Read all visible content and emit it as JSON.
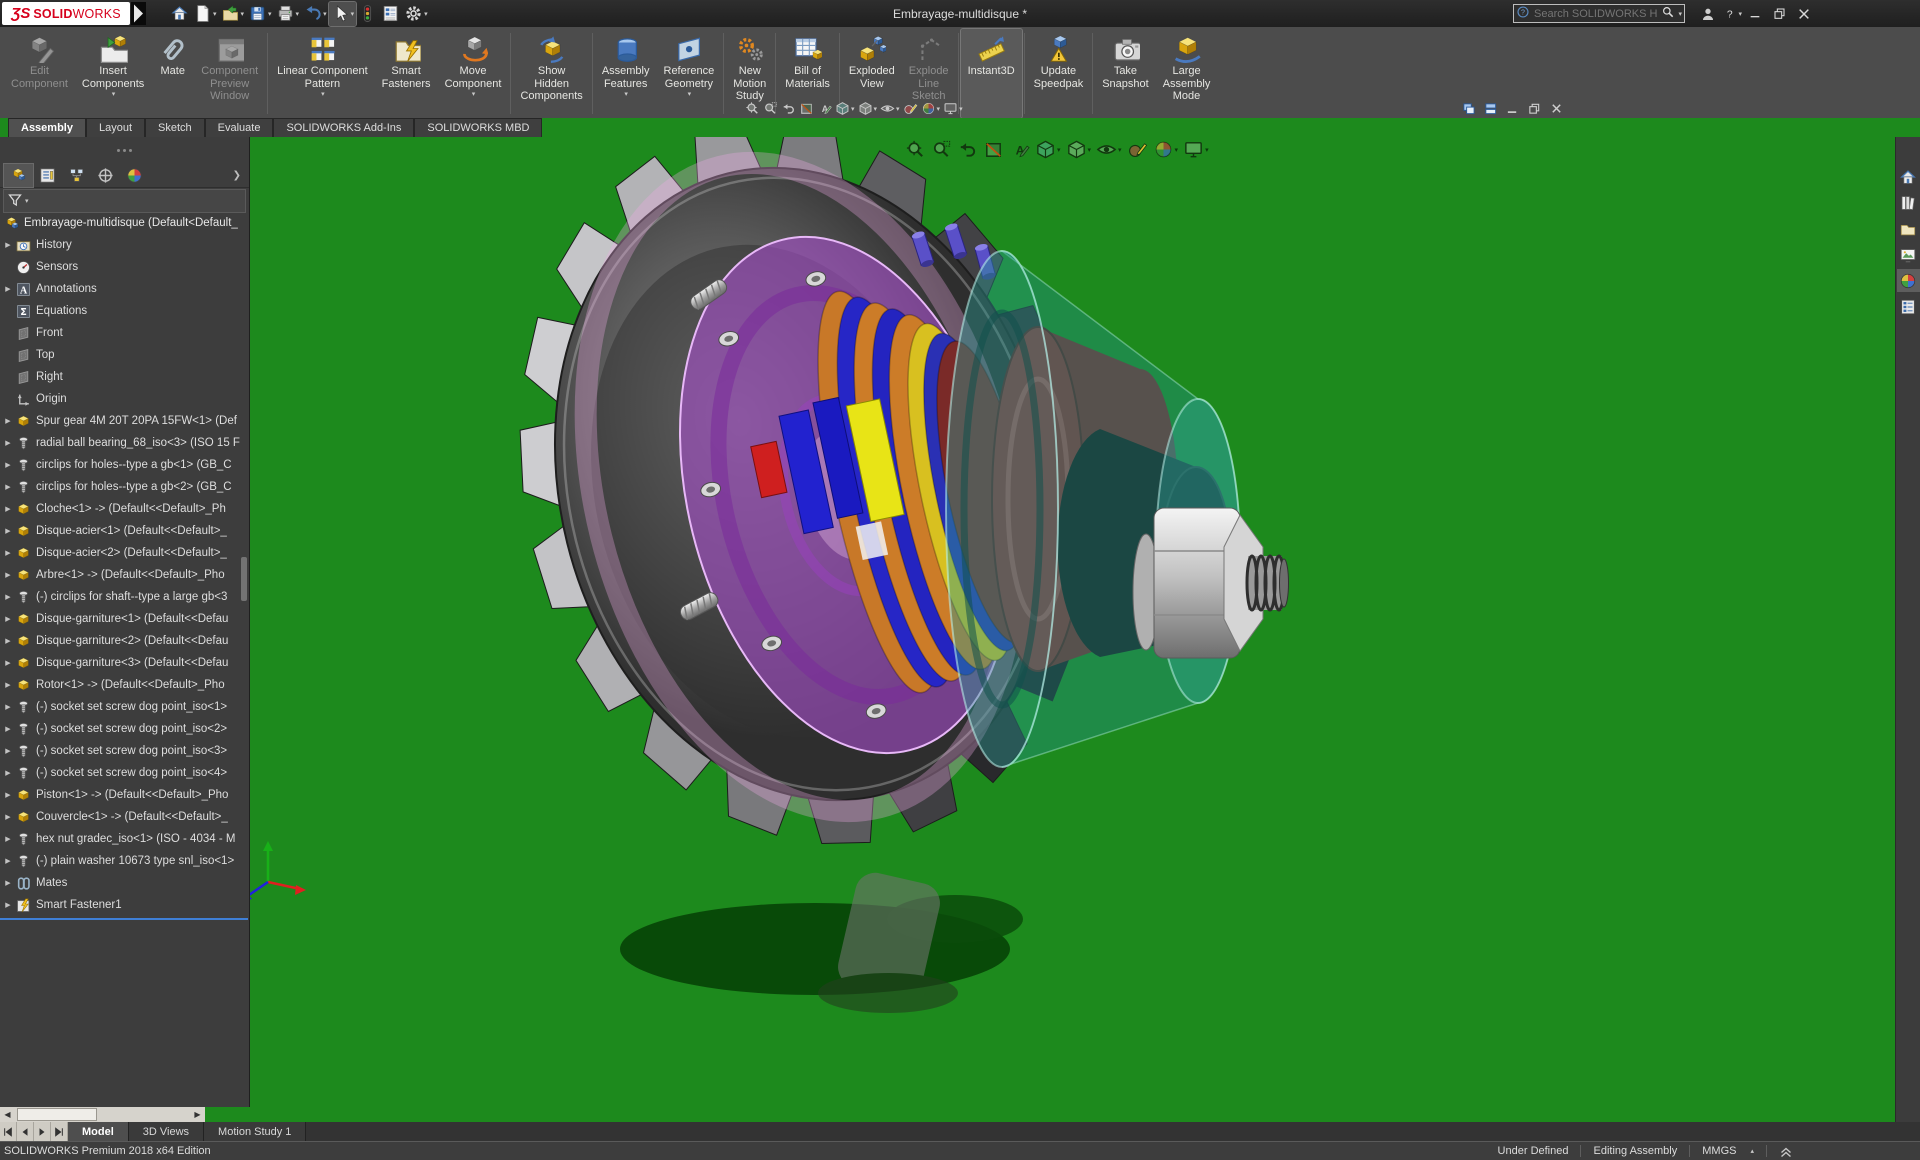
{
  "title_bar": {
    "logo_mark": "ƷS",
    "logo_bold": "SOLID",
    "logo_light": "WORKS",
    "document_title": "Embrayage-multidisque *",
    "search_placeholder": "Search SOLIDWORKS Help",
    "quick_access": [
      {
        "name": "home-icon",
        "icon": "home"
      },
      {
        "name": "new-document-icon",
        "icon": "newdoc",
        "caret": true
      },
      {
        "name": "open-icon",
        "icon": "open",
        "caret": true
      },
      {
        "name": "save-icon",
        "icon": "save",
        "caret": true
      },
      {
        "name": "print-icon",
        "icon": "print",
        "caret": true
      },
      {
        "name": "undo-icon",
        "icon": "undo",
        "caret": true
      },
      {
        "name": "select-icon",
        "icon": "select",
        "caret": true,
        "pressed": true
      },
      {
        "name": "performance-stoplight-icon",
        "icon": "stoplight"
      },
      {
        "name": "report-icon",
        "icon": "report"
      },
      {
        "name": "options-icon",
        "icon": "options",
        "caret": true
      }
    ],
    "right_controls": [
      {
        "name": "user-login-icon",
        "icon": "user"
      },
      {
        "name": "help-icon",
        "icon": "help",
        "caret": true
      },
      {
        "name": "minimize-button",
        "icon": "minimize"
      },
      {
        "name": "restore-button",
        "icon": "restore"
      },
      {
        "name": "close-button",
        "icon": "close"
      }
    ]
  },
  "ribbon": [
    {
      "label": "Edit\nComponent",
      "icon": "edit-component",
      "enabled": false
    },
    {
      "label": "Insert\nComponents",
      "icon": "insert-components",
      "caret": true
    },
    {
      "label": "Mate",
      "icon": "mate"
    },
    {
      "label": "Component\nPreview\nWindow",
      "icon": "component-preview-window",
      "enabled": false
    },
    {
      "sep": true
    },
    {
      "label": "Linear Component\nPattern",
      "icon": "linear-component-pattern",
      "caret": true
    },
    {
      "label": "Smart\nFasteners",
      "icon": "smart-fasteners"
    },
    {
      "label": "Move\nComponent",
      "icon": "move-component",
      "caret": true
    },
    {
      "sep": true
    },
    {
      "label": "Show\nHidden\nComponents",
      "icon": "show-hidden-components"
    },
    {
      "sep": true
    },
    {
      "label": "Assembly\nFeatures",
      "icon": "assembly-features",
      "caret": true
    },
    {
      "label": "Reference\nGeometry",
      "icon": "reference-geometry",
      "caret": true
    },
    {
      "sep": true
    },
    {
      "label": "New\nMotion\nStudy",
      "icon": "new-motion-study"
    },
    {
      "sep": true
    },
    {
      "label": "Bill of\nMaterials",
      "icon": "bill-of-materials"
    },
    {
      "sep": true
    },
    {
      "label": "Exploded\nView",
      "icon": "exploded-view"
    },
    {
      "label": "Explode\nLine\nSketch",
      "icon": "explode-line-sketch",
      "enabled": false
    },
    {
      "sep": true
    },
    {
      "label": "Instant3D",
      "icon": "instant3d",
      "pressed": true
    },
    {
      "sep": true
    },
    {
      "label": "Update\nSpeedpak",
      "icon": "update-speedpak"
    },
    {
      "sep": true
    },
    {
      "label": "Take\nSnapshot",
      "icon": "take-snapshot"
    },
    {
      "label": "Large\nAssembly\nMode",
      "icon": "large-assembly-mode"
    }
  ],
  "command_tabs": [
    {
      "label": "Assembly",
      "active": true
    },
    {
      "label": "Layout"
    },
    {
      "label": "Sketch"
    },
    {
      "label": "Evaluate"
    },
    {
      "label": "SOLIDWORKS Add-Ins"
    },
    {
      "label": "SOLIDWORKS MBD"
    }
  ],
  "doc_window_controls": [
    "cascade-windows-icon",
    "tile-windows-icon",
    "minimize-document-icon",
    "restore-document-icon",
    "close-document-icon"
  ],
  "heads_up_toolbar": [
    {
      "name": "zoom-to-fit-icon",
      "icon": "hud-zoomfit"
    },
    {
      "name": "zoom-to-area-icon",
      "icon": "hud-zoomarea"
    },
    {
      "name": "previous-view-icon",
      "icon": "hud-prev"
    },
    {
      "name": "section-view-icon",
      "icon": "hud-section"
    },
    {
      "name": "hide-show-annotations-icon",
      "icon": "hud-annot"
    },
    {
      "name": "view-orientation-icon",
      "icon": "hud-orient",
      "caret": true
    },
    {
      "name": "display-style-icon",
      "icon": "hud-display",
      "caret": true
    },
    {
      "name": "hide-show-items-icon",
      "icon": "hud-eye",
      "caret": true
    },
    {
      "name": "edit-appearance-icon",
      "icon": "hud-appearance"
    },
    {
      "name": "apply-scene-icon",
      "icon": "hud-scene",
      "caret": true
    },
    {
      "name": "view-settings-icon",
      "icon": "hud-monitor",
      "caret": true
    }
  ],
  "panel": {
    "tabs": [
      {
        "name": "featuremanager-design-tree-tab",
        "icon": "pt-fm",
        "active": true
      },
      {
        "name": "propertymanager-tab",
        "icon": "pt-pm"
      },
      {
        "name": "configurationmanager-tab",
        "icon": "pt-cm"
      },
      {
        "name": "dimxpertmanager-tab",
        "icon": "pt-dim"
      },
      {
        "name": "displaymanager-tab",
        "icon": "pt-disp"
      }
    ],
    "tree_root": {
      "label": "Embrayage-multidisque  (Default<Default_",
      "icon": "assembly-root"
    },
    "tree": [
      {
        "label": "History",
        "icon": "history",
        "arrow": true
      },
      {
        "label": "Sensors",
        "icon": "sensors"
      },
      {
        "label": "Annotations",
        "icon": "annotations",
        "arrow": true
      },
      {
        "label": "Equations",
        "icon": "equations"
      },
      {
        "label": "Front",
        "icon": "plane"
      },
      {
        "label": "Top",
        "icon": "plane"
      },
      {
        "label": "Right",
        "icon": "plane"
      },
      {
        "label": "Origin",
        "icon": "origin"
      },
      {
        "label": "Spur gear 4M 20T 20PA 15FW<1>  (Def",
        "icon": "part",
        "arrow": true
      },
      {
        "label": "radial ball bearing_68_iso<3>  (ISO 15 F",
        "icon": "fastener",
        "arrow": true
      },
      {
        "label": "circlips for holes--type a gb<1>  (GB_C",
        "icon": "fastener",
        "arrow": true
      },
      {
        "label": "circlips for holes--type a gb<2>  (GB_C",
        "icon": "fastener",
        "arrow": true
      },
      {
        "label": "Cloche<1> ->  (Default<<Default>_Ph",
        "icon": "part",
        "arrow": true
      },
      {
        "label": "Disque-acier<1>  (Default<<Default>_",
        "icon": "part",
        "arrow": true
      },
      {
        "label": "Disque-acier<2>  (Default<<Default>_",
        "icon": "part",
        "arrow": true
      },
      {
        "label": "Arbre<1> ->  (Default<<Default>_Pho",
        "icon": "part",
        "arrow": true
      },
      {
        "label": "(-) circlips for shaft--type a large gb<3",
        "icon": "fastener",
        "arrow": true
      },
      {
        "label": "Disque-garniture<1>  (Default<<Defau",
        "icon": "part",
        "arrow": true
      },
      {
        "label": "Disque-garniture<2>  (Default<<Defau",
        "icon": "part",
        "arrow": true
      },
      {
        "label": "Disque-garniture<3>  (Default<<Defau",
        "icon": "part",
        "arrow": true
      },
      {
        "label": "Rotor<1> ->  (Default<<Default>_Pho",
        "icon": "part",
        "arrow": true
      },
      {
        "label": "(-) socket set screw dog point_iso<1>",
        "icon": "fastener",
        "arrow": true
      },
      {
        "label": "(-) socket set screw dog point_iso<2>",
        "icon": "fastener",
        "arrow": true
      },
      {
        "label": "(-) socket set screw dog point_iso<3>",
        "icon": "fastener",
        "arrow": true
      },
      {
        "label": "(-) socket set screw dog point_iso<4>",
        "icon": "fastener",
        "arrow": true
      },
      {
        "label": "Piston<1> ->  (Default<<Default>_Pho",
        "icon": "part",
        "arrow": true
      },
      {
        "label": "Couvercle<1> ->  (Default<<Default>_",
        "icon": "part",
        "arrow": true
      },
      {
        "label": "hex nut gradec_iso<1>  (ISO - 4034 - M",
        "icon": "fastener",
        "arrow": true
      },
      {
        "label": "(-) plain washer 10673 type snl_iso<1>",
        "icon": "fastener",
        "arrow": true
      },
      {
        "label": "Mates",
        "icon": "mates",
        "arrow": true
      },
      {
        "label": "Smart Fastener1",
        "icon": "smart-fastener",
        "arrow": true,
        "selected": true
      }
    ]
  },
  "task_pane": [
    {
      "name": "solidworks-resources-icon",
      "icon": "tp-home"
    },
    {
      "name": "design-library-icon",
      "icon": "tp-library"
    },
    {
      "name": "file-explorer-icon",
      "icon": "tp-folder"
    },
    {
      "name": "view-palette-icon",
      "icon": "tp-palette"
    },
    {
      "name": "appearances-scenes-icon",
      "icon": "tp-appearance",
      "active": true
    },
    {
      "name": "custom-properties-icon",
      "icon": "tp-props"
    }
  ],
  "document_tabs": {
    "media_buttons": [
      {
        "name": "tab-scroll-first-button",
        "icon": "m-first"
      },
      {
        "name": "tab-scroll-prev-button",
        "icon": "m-prev"
      },
      {
        "name": "tab-scroll-next-button",
        "icon": "m-next"
      },
      {
        "name": "tab-scroll-last-button",
        "icon": "m-last"
      }
    ],
    "tabs": [
      {
        "label": "Model",
        "active": true
      },
      {
        "label": "3D Views"
      },
      {
        "label": "Motion Study 1"
      }
    ]
  },
  "status_bar": {
    "left": "SOLIDWORKS Premium 2018 x64 Edition",
    "items": [
      {
        "label": "Under Defined"
      },
      {
        "label": "Editing Assembly"
      },
      {
        "label": "MMGS",
        "caret": true
      },
      {
        "icon": "status-expand-icon"
      }
    ]
  },
  "viewport": {
    "background_color": "#1d8a1d",
    "model": "Embrayage multidisque (multi-plate clutch) assembly",
    "triad_colors": {
      "x": "#e02020",
      "y": "#18b018",
      "z": "#2020e0"
    }
  }
}
